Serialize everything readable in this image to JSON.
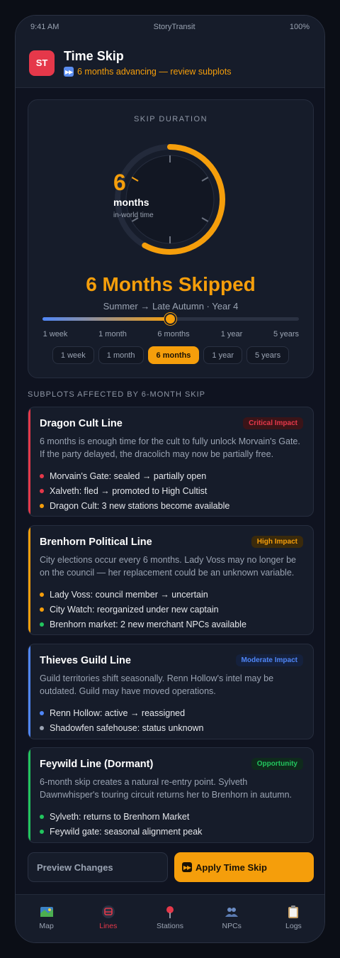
{
  "status_bar": {
    "time": "9:41 AM",
    "app": "StoryTransit",
    "battery": "100%"
  },
  "header": {
    "logo": "ST",
    "title": "Time Skip",
    "subtitle": "6 months advancing — review subplots",
    "subtitle_icon": "fast-forward-icon"
  },
  "skip": {
    "label": "SKIP DURATION",
    "dial_value": "6",
    "dial_unit": "months",
    "dial_caption": "in-world time",
    "dial_progress": 0.58,
    "headline": "6 Months Skipped",
    "season": "Summer → Late Autumn · Year 4",
    "slider_position": 0.5,
    "ticks": [
      "1 week",
      "1 month",
      "6 months",
      "1 year",
      "5 years"
    ],
    "chips": [
      "1 week",
      "1 month",
      "6 months",
      "1 year",
      "5 years"
    ],
    "selected_chip": "6 months"
  },
  "section_title": "SUBPLOTS AFFECTED BY 6-MONTH SKIP",
  "subplots": [
    {
      "title": "Dragon Cult Line",
      "badge": "Critical Impact",
      "color": "#e5384a",
      "badge_bg": "#3a1418",
      "description": "6 months is enough time for the cult to fully unlock Morvain's Gate. If the party delayed, the dracolich may now be partially free.",
      "bullets": [
        {
          "text": "Morvain's Gate: sealed → partially open",
          "color": "#e5384a"
        },
        {
          "text": "Xalveth: fled → promoted to High Cultist",
          "color": "#e5384a"
        },
        {
          "text": "Dragon Cult: 3 new stations become available",
          "color": "#f59e0b"
        }
      ]
    },
    {
      "title": "Brenhorn Political Line",
      "badge": "High Impact",
      "color": "#f59e0b",
      "badge_bg": "#3a2a0c",
      "description": "City elections occur every 6 months. Lady Voss may no longer be on the council — her replacement could be an unknown variable.",
      "bullets": [
        {
          "text": "Lady Voss: council member → uncertain",
          "color": "#f59e0b"
        },
        {
          "text": "City Watch: reorganized under new captain",
          "color": "#f59e0b"
        },
        {
          "text": "Brenhorn market: 2 new merchant NPCs available",
          "color": "#22c55e"
        }
      ]
    },
    {
      "title": "Thieves Guild Line",
      "badge": "Moderate Impact",
      "color": "#4f86f7",
      "badge_bg": "#15213d",
      "description": "Guild territories shift seasonally. Renn Hollow's intel may be outdated. Guild may have moved operations.",
      "bullets": [
        {
          "text": "Renn Hollow: active → reassigned",
          "color": "#4f86f7"
        },
        {
          "text": "Shadowfen safehouse: status unknown",
          "color": "#9aa3b2"
        }
      ]
    },
    {
      "title": "Feywild Line (Dormant)",
      "badge": "Opportunity",
      "color": "#22c55e",
      "badge_bg": "#0f2a1c",
      "description": "6-month skip creates a natural re-entry point. Sylveth Dawnwhisper's touring circuit returns her to Brenhorn in autumn.",
      "bullets": [
        {
          "text": "Sylveth: returns to Brenhorn Market",
          "color": "#22c55e"
        },
        {
          "text": "Feywild gate: seasonal alignment peak",
          "color": "#22c55e"
        }
      ]
    }
  ],
  "actions": {
    "preview": "Preview Changes",
    "apply": "Apply Time Skip",
    "apply_icon": "fast-forward-icon"
  },
  "tabs": [
    {
      "label": "Map",
      "icon": "map-icon"
    },
    {
      "label": "Lines",
      "icon": "train-icon",
      "active": true
    },
    {
      "label": "Stations",
      "icon": "pin-icon"
    },
    {
      "label": "NPCs",
      "icon": "people-icon"
    },
    {
      "label": "Logs",
      "icon": "clipboard-icon"
    }
  ]
}
